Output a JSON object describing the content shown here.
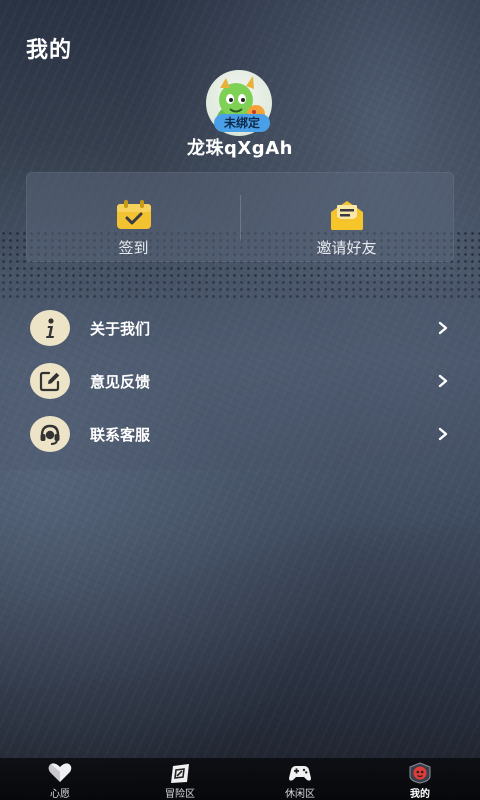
{
  "header": {
    "title": "我的"
  },
  "profile": {
    "badge": "未绑定",
    "username": "龙珠qXgAh"
  },
  "actions": [
    {
      "label": "签到",
      "icon": "calendar-check-icon"
    },
    {
      "label": "邀请好友",
      "icon": "envelope-open-icon"
    }
  ],
  "menu": [
    {
      "label": "关于我们",
      "icon": "info-icon"
    },
    {
      "label": "意见反馈",
      "icon": "edit-icon"
    },
    {
      "label": "联系客服",
      "icon": "headset-icon"
    }
  ],
  "tabs": [
    {
      "label": "心愿",
      "icon": "heart-icon",
      "active": false
    },
    {
      "label": "冒险区",
      "icon": "map-icon",
      "active": false
    },
    {
      "label": "休闲区",
      "icon": "gamepad-icon",
      "active": false
    },
    {
      "label": "我的",
      "icon": "profile-icon",
      "active": true
    }
  ],
  "colors": {
    "menu_icon_bg": "#ede4c8",
    "action_icon": "#f2c230",
    "badge_bg": "#4aa0e8",
    "tab_active": "#e23b3b"
  }
}
